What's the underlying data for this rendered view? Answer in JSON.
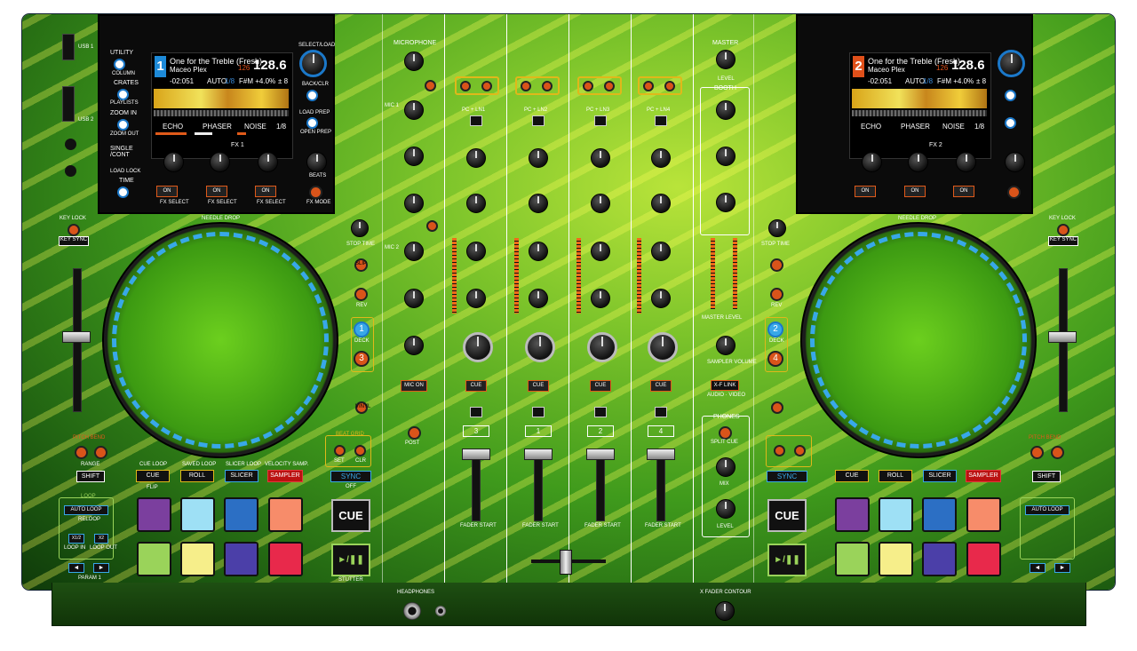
{
  "left_deck": {
    "screen": {
      "deck_number": "1",
      "track_title": "One for the Treble (Fresh)",
      "artist": "Maceo Plex",
      "bpm": "128.6",
      "time_remaining": "-02:051",
      "key_small": "126",
      "auto": "AUTO",
      "loop_fraction": "1/8",
      "key_pitch": "F#M +4.0%",
      "key_range": "± 8",
      "fx_names": [
        "ECHO",
        "PHASER",
        "NOISE"
      ],
      "beats": "1/8",
      "fx_label": "FX 1"
    },
    "side_labels": [
      "UTILITY",
      "VIEW",
      "COLUMN",
      "CRATES",
      "PLAYLISTS",
      "ZOOM IN",
      "ZOOM OUT",
      "SINGLE /CONT",
      "LOAD LOCK",
      "TIME"
    ],
    "right_labels": [
      "SELECT/LOAD",
      "BACK/CLR",
      "LOAD PREP",
      "OPEN PREP"
    ],
    "fx_knob_labels": [
      "MIN",
      "MAX"
    ],
    "fx_on": [
      "ON",
      "ON",
      "ON"
    ],
    "fx_select": [
      "FX SELECT",
      "FX SELECT",
      "FX SELECT"
    ],
    "beats_label": "BEATS",
    "tap": "TAP",
    "fx_mode": "FX MODE",
    "needle_drop": "NEEDLE DROP",
    "key_lock": "KEY LOCK",
    "key_sync": "KEY SYNC",
    "stop_time": "STOP TIME",
    "slip": "SLIP",
    "rev": "REV",
    "deck_a": "1",
    "deck_b": "3",
    "deck_label": "DECK",
    "vinyl": "VINYL",
    "pitch_bend": "PITCH BEND",
    "range": "RANGE",
    "shift": "SHIFT",
    "beat_grid": "BEAT GRID",
    "adjust": "ADJUST",
    "slide": "SLIDE",
    "set": "SET",
    "clr": "CLR",
    "sync": "SYNC",
    "off": "OFF",
    "cue_big": "CUE",
    "play_label": "STUTTER",
    "mode_tops": [
      "CUE LOOP",
      "SAVED LOOP",
      "SLICER LOOP",
      "VELOCITY SAMP."
    ],
    "modes": [
      "CUE",
      "ROLL",
      "SLICER",
      "SAMPLER"
    ],
    "flip": "FLIP",
    "loop": "LOOP",
    "auto_loop": "AUTO LOOP",
    "reloop": "RELOOP",
    "x12": "X1/2",
    "x2": "X2",
    "loop_in": "LOOP IN",
    "loop_out": "LOOP OUT",
    "param": "PARAM 1",
    "param2": "2",
    "usb": [
      "USB 1",
      "USB 2",
      "USB 1 EJECT",
      "USB 2 EJECT"
    ]
  },
  "right_deck": {
    "screen": {
      "deck_number": "2",
      "track_title": "One for the Treble (Fresh)",
      "artist": "Maceo Plex",
      "bpm": "128.6",
      "time_remaining": "-02:051",
      "key_small": "126",
      "auto": "AUTO",
      "loop_fraction": "1/8",
      "key_pitch": "F#M +4.0%",
      "key_range": "± 8",
      "fx_names": [
        "ECHO",
        "PHASER",
        "NOISE"
      ],
      "beats": "1/8",
      "fx_label": "FX 2"
    },
    "deck_a": "2",
    "deck_b": "4"
  },
  "mixer": {
    "microphone": "MICROPHONE",
    "mic_labels": [
      "LEVEL",
      "ECHO",
      "HI",
      "LOW",
      "LEVEL",
      "ECHO",
      "HI",
      "LOW",
      "MIC ECHO"
    ],
    "mic_on": "MIC ON",
    "post": "POST",
    "talk_over": "TALK OVER",
    "mic1": "MIC 1",
    "mic2": "MIC 2",
    "channel_labels": [
      "PC + LN1",
      "PC + LN2",
      "PC + LN3",
      "PC + LN4"
    ],
    "knob_labels": [
      "LEVEL",
      "HI",
      "MID",
      "LOW",
      "FILTER"
    ],
    "cue_label": "CUE",
    "channel_numbers": [
      "3",
      "1",
      "2",
      "4"
    ],
    "fader_start": "FADER START",
    "fx": "FX",
    "master": "MASTER",
    "master_level": "LEVEL",
    "booth": "BOOTH",
    "booth_labels": [
      "LEVEL",
      "HI",
      "LOW"
    ],
    "master_level_label": "MASTER LEVEL",
    "sampler_volume": "SAMPLER VOLUME",
    "xf_link": "X-F LINK",
    "audio_video": "AUDIO · VIDEO",
    "phones": "PHONES",
    "split_cue": "SPLIT CUE",
    "mix": "MIX",
    "cue_master": [
      "CUE",
      "MASTER"
    ],
    "level": "LEVEL",
    "min_max": [
      "MIN",
      "MAX"
    ]
  },
  "bottom": {
    "headphones": "HEADPHONES",
    "x_fader_contour": "X FADER CONTOUR"
  },
  "colors": {
    "accent_orange": "#e05a1a",
    "accent_blue": "#1b78c9",
    "deck1_tag": "#1d8ad8",
    "deck2_tag": "#e0501a"
  }
}
